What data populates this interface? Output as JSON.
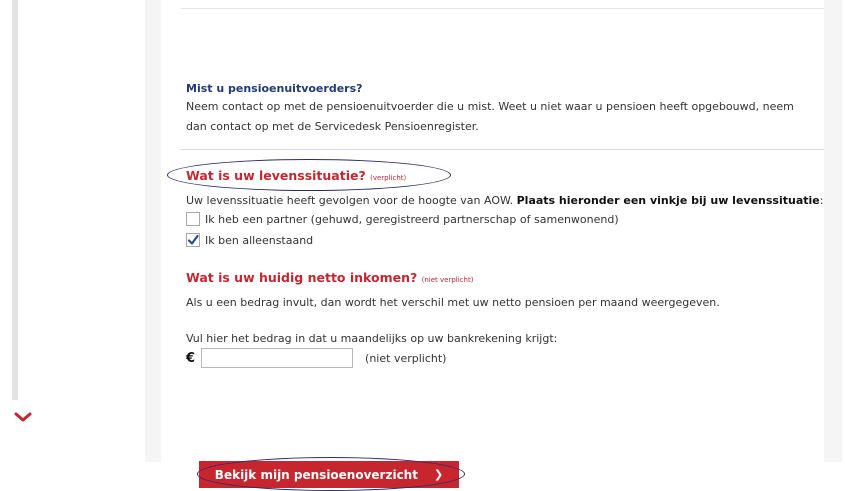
{
  "missing": {
    "title": "Mist u pensioenuitvoerders?",
    "text": "Neem contact op met de pensioenuitvoerder die u mist. Weet u niet waar u pensioen heeft opgebouwd, neem dan contact op met de Servicedesk Pensioenregister."
  },
  "living": {
    "heading": "Wat is uw levenssituatie?",
    "required_tag": "(verplicht)",
    "intro": "Uw levenssituatie heeft gevolgen voor de hoogte van AOW. ",
    "intro_bold": "Plaats hieronder een vinkje bij uw levenssituatie",
    "intro_end": ":",
    "options": [
      {
        "label": "Ik heb een partner (gehuwd, geregistreerd partnerschap of samenwonend)",
        "checked": false
      },
      {
        "label": "Ik ben alleenstaand",
        "checked": true
      }
    ]
  },
  "income": {
    "heading": "Wat is uw huidig netto inkomen?",
    "optional_tag": "(niet verplicht)",
    "info": "Als u een bedrag invult, dan wordt het verschil met uw netto pensioen per maand weergegeven.",
    "prompt": "Vul hier het bedrag in dat u maandelijks op uw bankrekening krijgt:",
    "currency": "€",
    "value": "",
    "field_note": "(niet verplicht)"
  },
  "submit": {
    "label": "Bekijk mijn pensioenoverzicht",
    "arrow": "❯"
  },
  "colors": {
    "accent_red": "#c8262f",
    "title_blue": "#223a7a",
    "annotation_ellipse": "#2a2a6e"
  }
}
